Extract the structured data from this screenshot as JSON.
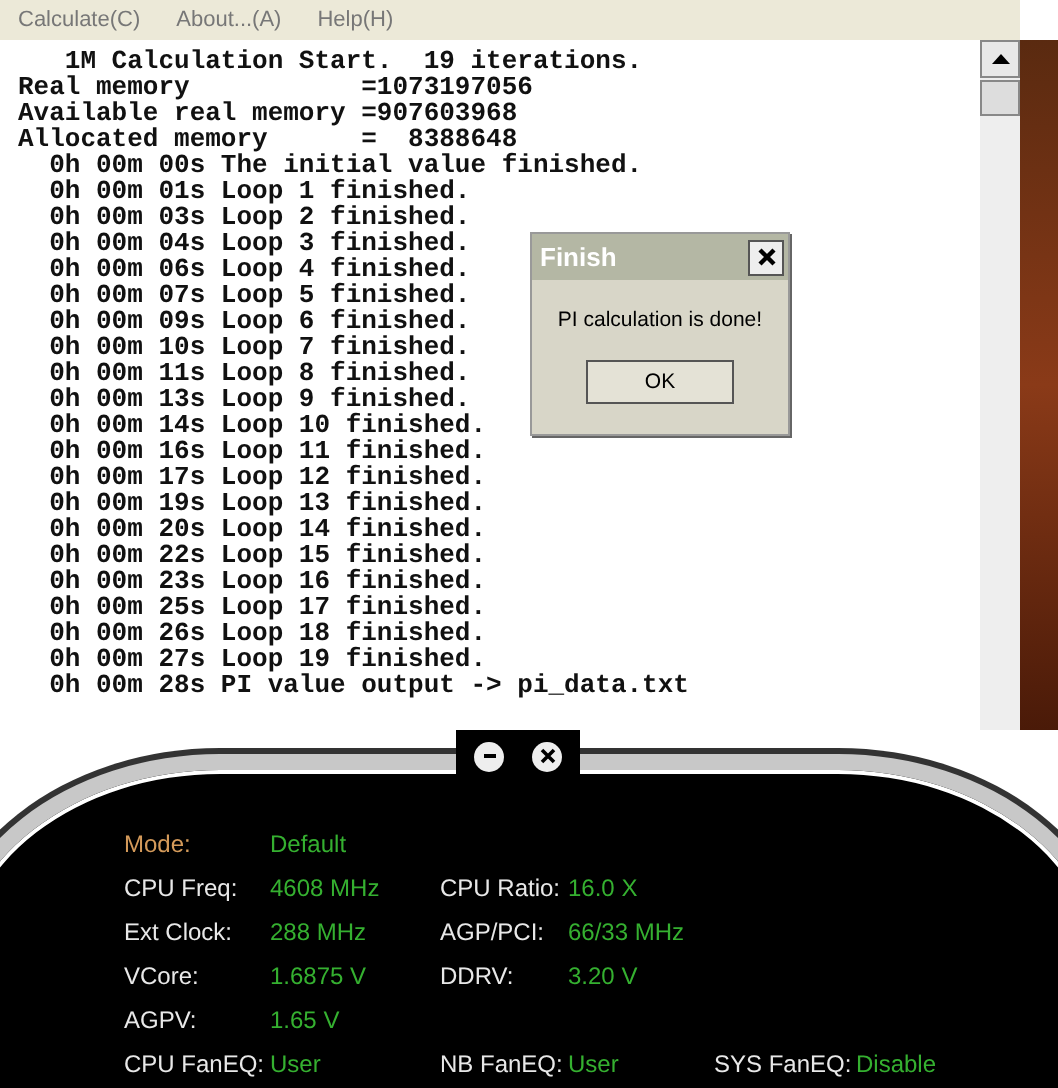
{
  "menu": [
    "Calculate(C)",
    "About...(A)",
    "Help(H)"
  ],
  "log": [
    "   1M Calculation Start.  19 iterations.",
    "Real memory           =1073197056",
    "Available real memory =907603968",
    "Allocated memory      =  8388648",
    "  0h 00m 00s The initial value finished.",
    "  0h 00m 01s Loop 1 finished.",
    "  0h 00m 03s Loop 2 finished.",
    "  0h 00m 04s Loop 3 finished.",
    "  0h 00m 06s Loop 4 finished.",
    "  0h 00m 07s Loop 5 finished.",
    "  0h 00m 09s Loop 6 finished.",
    "  0h 00m 10s Loop 7 finished.",
    "  0h 00m 11s Loop 8 finished.",
    "  0h 00m 13s Loop 9 finished.",
    "  0h 00m 14s Loop 10 finished.",
    "  0h 00m 16s Loop 11 finished.",
    "  0h 00m 17s Loop 12 finished.",
    "  0h 00m 19s Loop 13 finished.",
    "  0h 00m 20s Loop 14 finished.",
    "  0h 00m 22s Loop 15 finished.",
    "  0h 00m 23s Loop 16 finished.",
    "  0h 00m 25s Loop 17 finished.",
    "  0h 00m 26s Loop 18 finished.",
    "  0h 00m 27s Loop 19 finished.",
    "  0h 00m 28s PI value output -> pi_data.txt"
  ],
  "dialog": {
    "title": "Finish",
    "message": "PI calculation is done!",
    "button": "OK"
  },
  "panel": {
    "mode": {
      "label": "Mode:",
      "value": "Default"
    },
    "rows": [
      [
        {
          "label": "CPU Freq:",
          "value": "4608 MHz"
        },
        {
          "label": "CPU Ratio:",
          "value": "16.0 X"
        }
      ],
      [
        {
          "label": "Ext Clock:",
          "value": "288 MHz"
        },
        {
          "label": "AGP/PCI:",
          "value": "66/33 MHz"
        }
      ],
      [
        {
          "label": "VCore:",
          "value": "1.6875 V"
        },
        {
          "label": "DDRV:",
          "value": "3.20 V"
        }
      ],
      [
        {
          "label": "AGPV:",
          "value": "1.65 V"
        }
      ],
      [
        {
          "label": "CPU FanEQ:",
          "value": "User"
        },
        {
          "label": "NB FanEQ:",
          "value": "User"
        },
        {
          "label": "SYS FanEQ:",
          "value": "Disable"
        }
      ]
    ]
  }
}
